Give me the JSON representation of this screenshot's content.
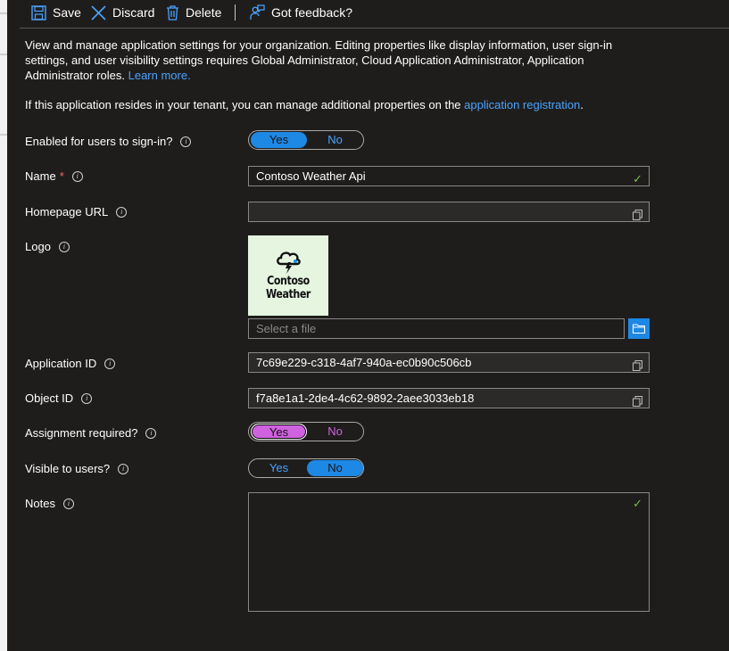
{
  "toolbar": {
    "save_label": "Save",
    "discard_label": "Discard",
    "delete_label": "Delete",
    "feedback_label": "Got feedback?"
  },
  "intro": {
    "paragraph1": "View and manage application settings for your organization. Editing properties like display information, user sign-in settings, and user visibility settings requires Global Administrator, Cloud Application Administrator, Application Administrator roles.",
    "learn_more": "Learn more.",
    "paragraph2_prefix": "If this application resides in your tenant, you can manage additional properties on the",
    "app_registration_link": "application registration",
    "paragraph2_suffix": "."
  },
  "form": {
    "enabled_label": "Enabled for users to sign-in?",
    "enabled_value": "Yes",
    "name_label": "Name",
    "required_marker": "*",
    "name_value": "Contoso Weather Api",
    "homepage_label": "Homepage URL",
    "homepage_value": "",
    "logo_label": "Logo",
    "logo_text_line1": "Contoso",
    "logo_text_line2": "Weather",
    "file_placeholder": "Select a file",
    "app_id_label": "Application ID",
    "app_id_value": "7c69e229-c318-4af7-940a-ec0b90c506cb",
    "object_id_label": "Object ID",
    "object_id_value": "f7a8e1a1-2de4-4c62-9892-2aee3033eb18",
    "assignment_label": "Assignment required?",
    "assignment_value": "Yes",
    "visible_label": "Visible to users?",
    "visible_value": "No",
    "notes_label": "Notes",
    "notes_value": "",
    "yes_label": "Yes",
    "no_label": "No",
    "info_glyph": "i",
    "check_glyph": "✓"
  },
  "colors": {
    "background": "#1f1d1c",
    "accent": "#1e88e5",
    "link": "#4aa3ff",
    "focus_pink": "#d062e0",
    "valid_check": "#7fba42",
    "required": "#e86a6a",
    "logo_bg": "#e5f5e0"
  }
}
